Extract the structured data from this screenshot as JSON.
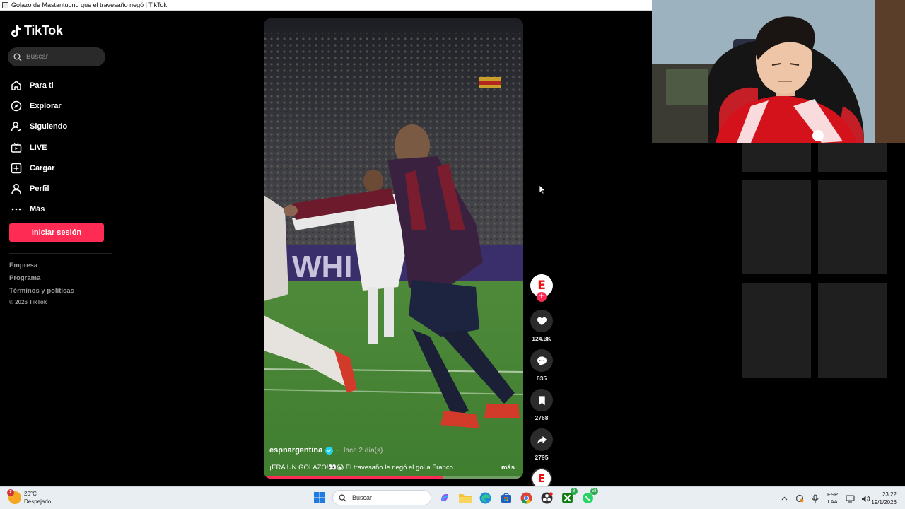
{
  "window": {
    "title": "Golazo de Mastantuono que el travesaño negó | TikTok"
  },
  "sidebar": {
    "logo": "TikTok",
    "search_placeholder": "Buscar",
    "items": [
      {
        "label": "Para ti",
        "icon": "home-icon"
      },
      {
        "label": "Explorar",
        "icon": "compass-icon"
      },
      {
        "label": "Siguiendo",
        "icon": "following-icon"
      },
      {
        "label": "LIVE",
        "icon": "live-icon"
      },
      {
        "label": "Cargar",
        "icon": "upload-icon"
      },
      {
        "label": "Perfil",
        "icon": "profile-icon"
      },
      {
        "label": "Más",
        "icon": "more-icon"
      }
    ],
    "login_label": "Iniciar sesión",
    "footer": [
      "Empresa",
      "Programa",
      "Términos y políticas"
    ],
    "copyright": "© 2026 TikTok"
  },
  "video": {
    "username": "espnargentina",
    "posted": "· Hace 2 día(s)",
    "caption": "¡ERA UN GOLAZO!👀😱 El travesaño le negó el gol a Franco ...",
    "more_label": "más",
    "progress": 0.69,
    "stadium_banner": "WHI"
  },
  "actions": {
    "likes": "124.3K",
    "comments": "635",
    "saves": "2768",
    "shares": "2795"
  },
  "taskbar": {
    "weather_temp": "20°C",
    "weather_desc": "Despejado",
    "weather_badge": "2",
    "search_label": "Buscar",
    "badges": {
      "xbox": "3",
      "whatsapp": "58"
    },
    "lang_top": "ESP",
    "lang_bottom": "LAA",
    "time": "23:22",
    "date": "19/1/2026"
  },
  "colors": {
    "accent": "#fe2c55",
    "verified": "#20d5ec",
    "espn": "#e11111"
  }
}
